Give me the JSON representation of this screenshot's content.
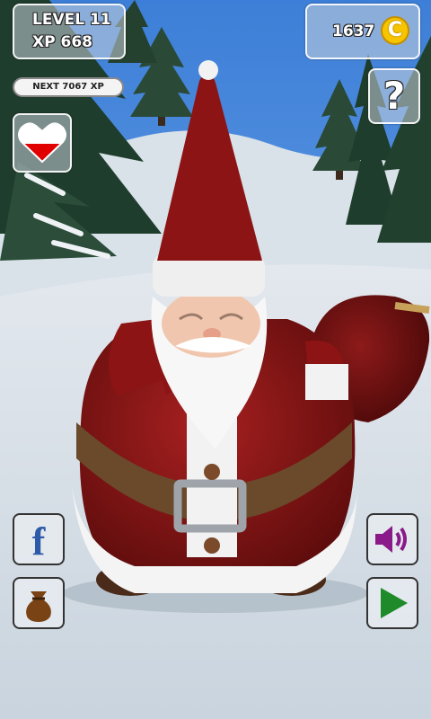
{
  "hud": {
    "level_label": "LEVEL 11",
    "xp_label": "XP 668",
    "next_xp_label": "NEXT 7067 XP",
    "coins": "1637",
    "coin_symbol": "C",
    "help_symbol": "?",
    "health_fill_fraction": 0.5
  },
  "buttons": {
    "facebook_glyph": "f"
  },
  "icons": [
    "heart-icon",
    "coin-icon",
    "help-icon",
    "facebook-icon",
    "bag-icon",
    "sound-icon",
    "play-icon"
  ],
  "colors": {
    "heart_red": "#e00000",
    "coin_gold": "#f7c500",
    "facebook_blue": "#2d5aa8",
    "sound_purple": "#8a1a8a",
    "play_green": "#1e8a2a",
    "santa_red": "#8c1414"
  }
}
